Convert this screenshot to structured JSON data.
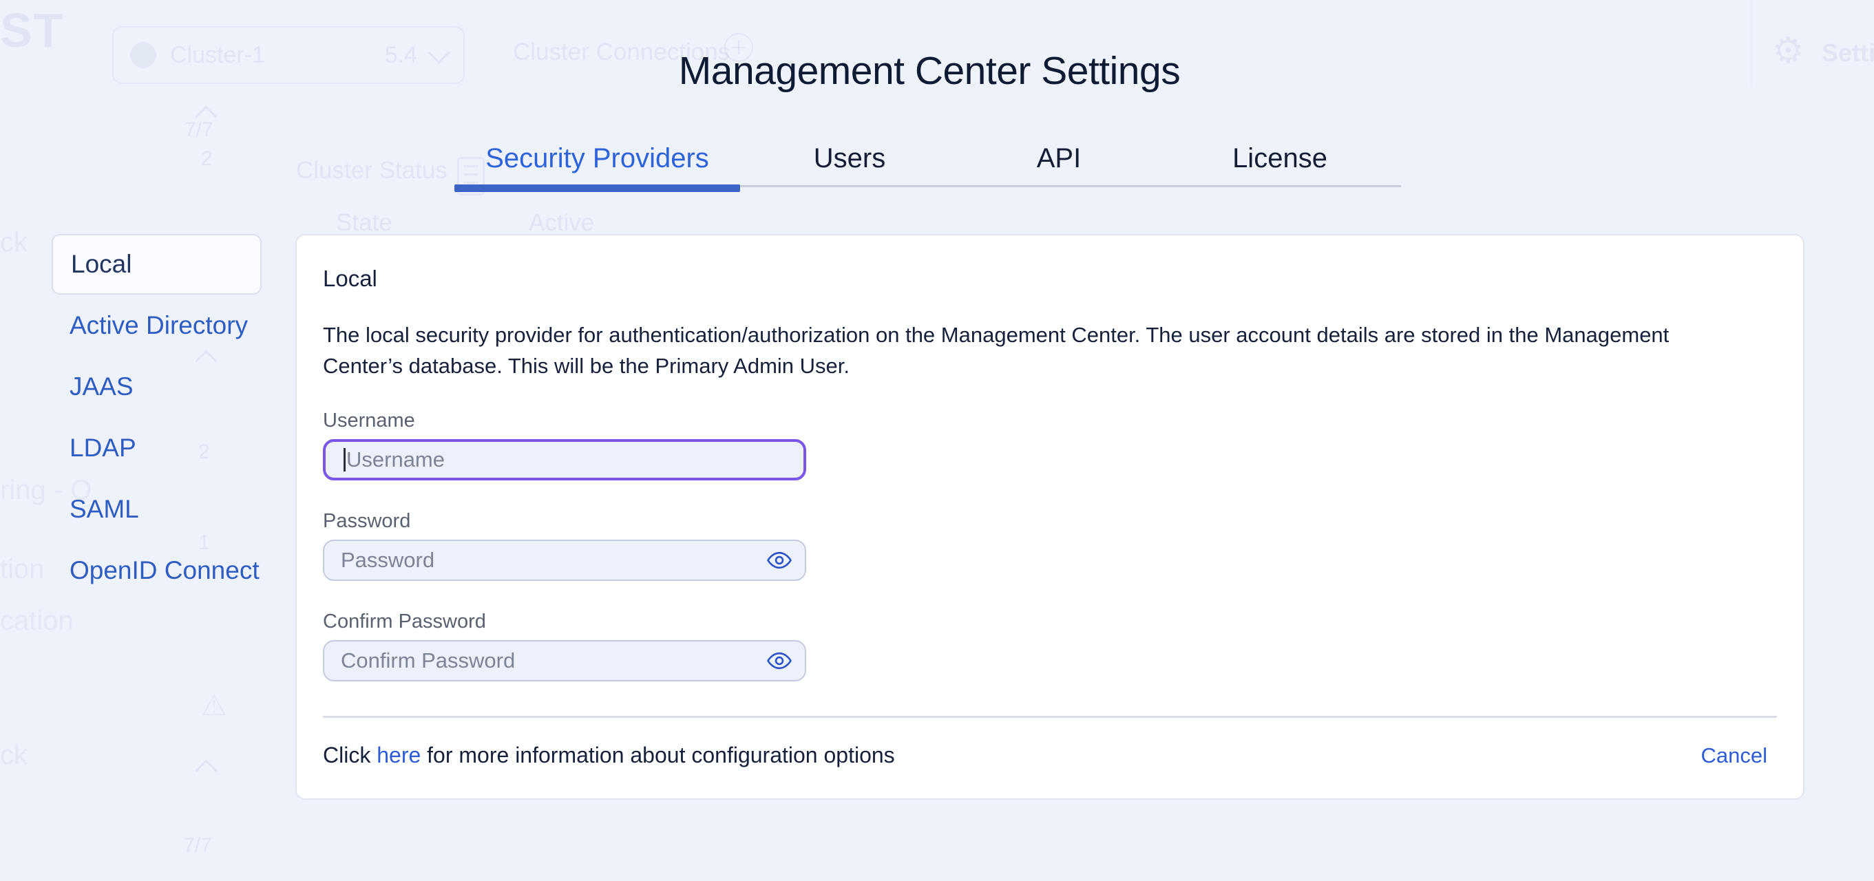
{
  "background": {
    "logo_fragment": "ST",
    "cluster_name": "Cluster-1",
    "cluster_version": "5.4",
    "connections_label": "Cluster Connections",
    "settings_label": "Settings",
    "cluster_status_label": "Cluster Status",
    "state_label": "State",
    "active_label": "Active",
    "badges": [
      "7/7",
      "2",
      "2",
      "1",
      "7/7"
    ],
    "fragments": [
      "ck",
      "ring - O",
      "tion",
      "cation",
      "ck"
    ]
  },
  "modal": {
    "title": "Management Center Settings",
    "tabs": [
      {
        "label": "Security Providers",
        "active": true
      },
      {
        "label": "Users",
        "active": false
      },
      {
        "label": "API",
        "active": false
      },
      {
        "label": "License",
        "active": false
      }
    ],
    "sidebar": {
      "selected": "Local",
      "items": [
        {
          "label": "Local"
        },
        {
          "label": "Active Directory"
        },
        {
          "label": "JAAS"
        },
        {
          "label": "LDAP"
        },
        {
          "label": "SAML"
        },
        {
          "label": "OpenID Connect"
        }
      ]
    },
    "panel": {
      "heading": "Local",
      "description": "The local security provider for authentication/authorization on the Management Center. The user account details are stored in the Management Center’s database. This will be the Primary Admin User.",
      "fields": [
        {
          "label": "Username",
          "placeholder": "Username",
          "focused": true
        },
        {
          "label": "Password",
          "placeholder": "Password",
          "has_eye": true
        },
        {
          "label": "Confirm Password",
          "placeholder": "Confirm Password",
          "has_eye": true
        }
      ],
      "footer": {
        "text_before": "Click ",
        "link_label": "here",
        "text_after": " for more information about configuration options",
        "cancel_label": "Cancel"
      }
    }
  },
  "colors": {
    "page_bg": "#eef2fb",
    "accent_blue": "#2e5cd8",
    "tab_indicator": "#3b64c6",
    "sidebar_link_blue": "#2e5cc2",
    "focus_violet": "#7a55e8",
    "eye_icon_blue": "#2b50c8",
    "input_bg": "#edf1fb",
    "input_border": "#c4cbde",
    "text_dark": "#16203a"
  }
}
